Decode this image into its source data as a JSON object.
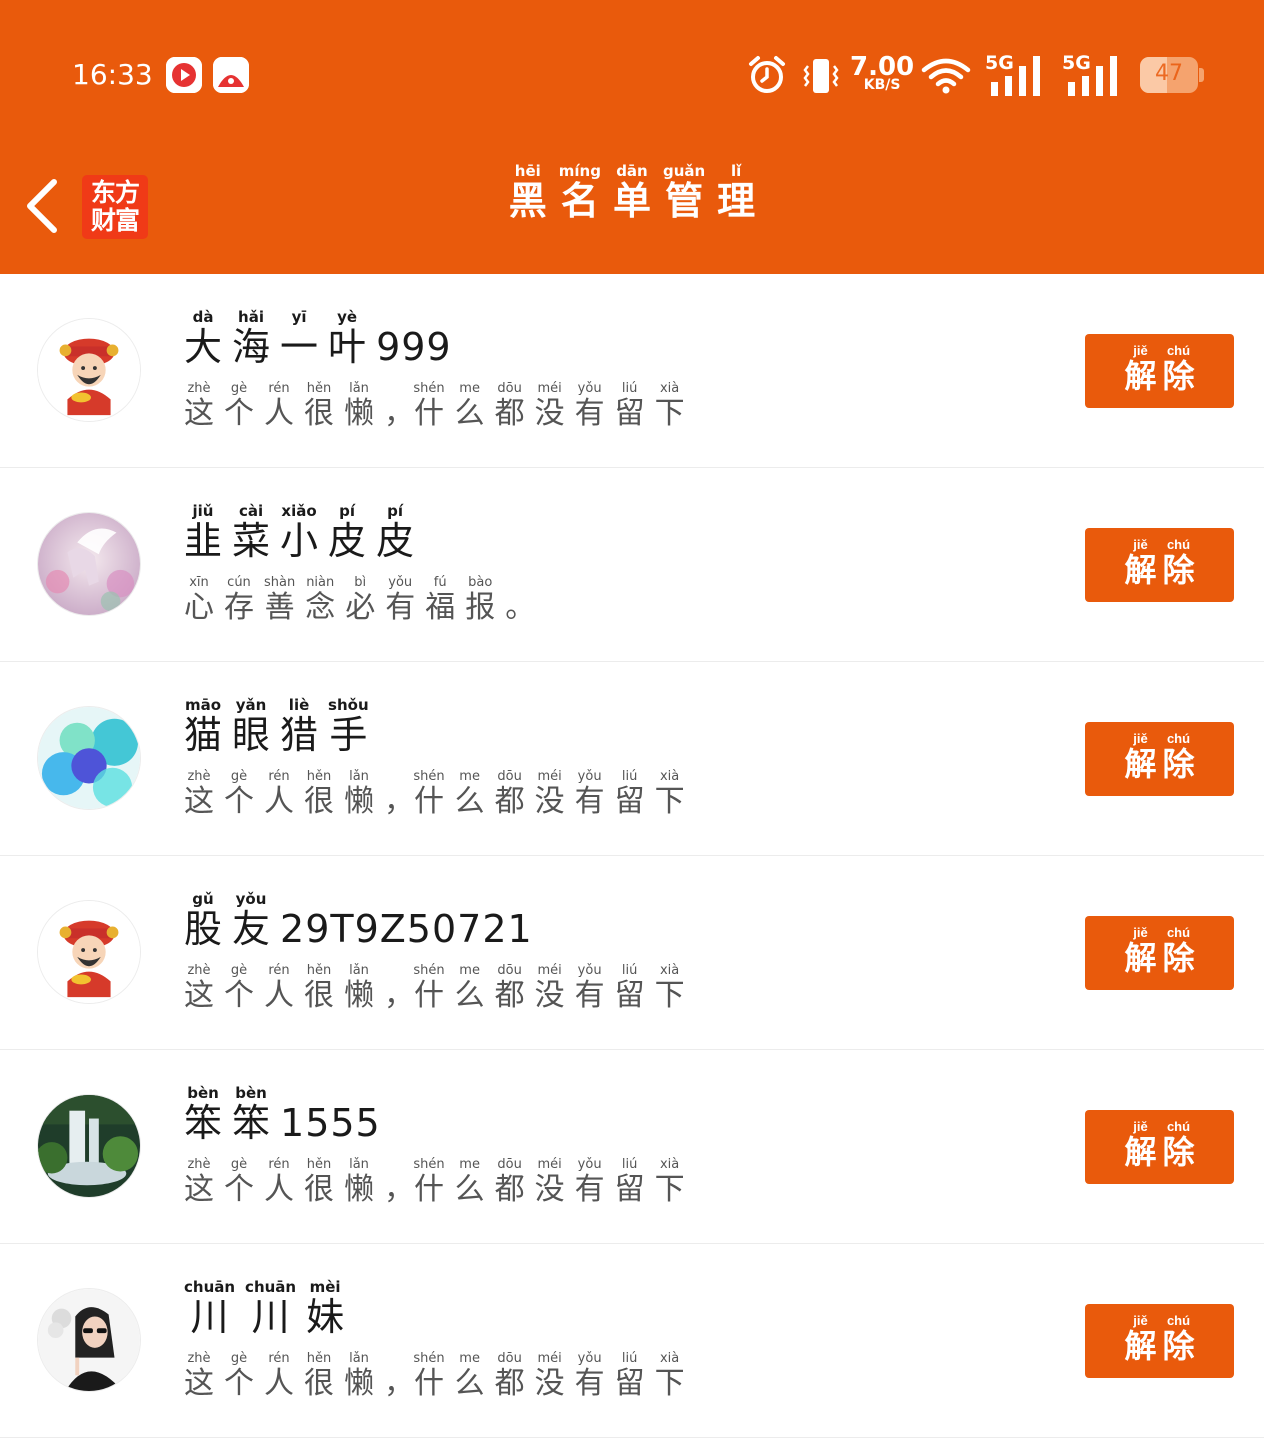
{
  "status_bar": {
    "time": "16:33",
    "net_speed_value": "7.00",
    "net_speed_unit": "KB/S",
    "network_1": "5G",
    "network_2": "5G",
    "battery": "47",
    "battery_level": 0.47,
    "icons": [
      "app-notification-icon",
      "app-notification-icon",
      "alarm-icon",
      "vibrate-icon",
      "wifi-icon",
      "signal-icon",
      "signal-icon",
      "battery-icon"
    ]
  },
  "nav": {
    "back_icon": "chevron-left-icon",
    "logo_line1": "东方",
    "logo_line2": "财富",
    "title": [
      {
        "char": "黑",
        "py": "hēi"
      },
      {
        "char": "名",
        "py": "míng"
      },
      {
        "char": "单",
        "py": "dān"
      },
      {
        "char": "管",
        "py": "guǎn"
      },
      {
        "char": "理",
        "py": "lǐ"
      }
    ]
  },
  "colors": {
    "brand": "#E95A0C",
    "text_primary": "#1a1a1a",
    "text_secondary": "#555555"
  },
  "remove_button": [
    {
      "char": "解",
      "py": "jiě"
    },
    {
      "char": "除",
      "py": "chú"
    }
  ],
  "users": [
    {
      "avatar": "god-of-wealth-avatar",
      "name": [
        {
          "char": "大",
          "py": "dà"
        },
        {
          "char": "海",
          "py": "hǎi"
        },
        {
          "char": "一",
          "py": "yī"
        },
        {
          "char": "叶",
          "py": "yè"
        },
        {
          "text": "999"
        }
      ],
      "signature": "lazy"
    },
    {
      "avatar": "pegasus-avatar",
      "name": [
        {
          "char": "韭",
          "py": "jiǔ"
        },
        {
          "char": "菜",
          "py": "cài"
        },
        {
          "char": "小",
          "py": "xiǎo"
        },
        {
          "char": "皮",
          "py": "pí"
        },
        {
          "char": "皮",
          "py": "pí"
        }
      ],
      "signature": "custom"
    },
    {
      "avatar": "bubbles-avatar",
      "name": [
        {
          "char": "猫",
          "py": "māo"
        },
        {
          "char": "眼",
          "py": "yǎn"
        },
        {
          "char": "猎",
          "py": "liè"
        },
        {
          "char": "手",
          "py": "shǒu"
        }
      ],
      "signature": "lazy"
    },
    {
      "avatar": "god-of-wealth-avatar",
      "name": [
        {
          "char": "股",
          "py": "gǔ"
        },
        {
          "char": "友",
          "py": "yǒu"
        },
        {
          "text": "29T9Z50721"
        }
      ],
      "signature": "lazy"
    },
    {
      "avatar": "waterfall-avatar",
      "name": [
        {
          "char": "笨",
          "py": "bèn"
        },
        {
          "char": "笨",
          "py": "bèn"
        },
        {
          "text": "1555"
        }
      ],
      "signature": "lazy"
    },
    {
      "avatar": "woman-avatar",
      "name": [
        {
          "char": "川",
          "py": "chuān"
        },
        {
          "char": "川",
          "py": "chuān"
        },
        {
          "char": "妹",
          "py": "mèi"
        }
      ],
      "signature": "lazy"
    }
  ],
  "signatures": {
    "lazy": [
      {
        "char": "这",
        "py": "zhè"
      },
      {
        "char": "个",
        "py": "gè"
      },
      {
        "char": "人",
        "py": "rén"
      },
      {
        "char": "很",
        "py": "hěn"
      },
      {
        "char": "懒",
        "py": "lǎn"
      },
      {
        "text": "，"
      },
      {
        "char": "什",
        "py": "shén"
      },
      {
        "char": "么",
        "py": "me"
      },
      {
        "char": "都",
        "py": "dōu"
      },
      {
        "char": "没",
        "py": "méi"
      },
      {
        "char": "有",
        "py": "yǒu"
      },
      {
        "char": "留",
        "py": "liú"
      },
      {
        "char": "下",
        "py": "xià"
      }
    ],
    "custom": [
      {
        "char": "心",
        "py": "xīn"
      },
      {
        "char": "存",
        "py": "cún"
      },
      {
        "char": "善",
        "py": "shàn"
      },
      {
        "char": "念",
        "py": "niàn"
      },
      {
        "char": "必",
        "py": "bì"
      },
      {
        "char": "有",
        "py": "yǒu"
      },
      {
        "char": "福",
        "py": "fú"
      },
      {
        "char": "报",
        "py": "bào"
      },
      {
        "text": "。"
      }
    ]
  }
}
